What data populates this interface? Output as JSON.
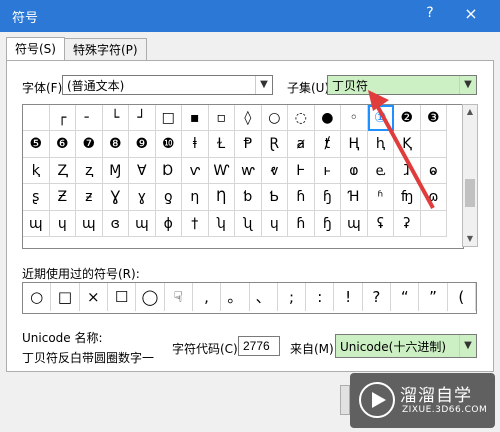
{
  "window": {
    "title": "符号",
    "help": "?",
    "close": "×"
  },
  "tabs": [
    {
      "label": "符号(S)"
    },
    {
      "label": "特殊字符(P)"
    }
  ],
  "font": {
    "label": "字体(F):",
    "value": "(普通文本)"
  },
  "subset": {
    "label": "子集(U):",
    "value": "丁贝符"
  },
  "symbols": [
    [
      "",
      "┌",
      "╴",
      "└",
      "┘",
      "□",
      "▪",
      "▫",
      "◊",
      "○",
      "◌",
      "●",
      "◦",
      "①",
      "❷",
      "❸",
      "❹"
    ],
    [
      "❺",
      "❻",
      "❼",
      "❽",
      "❾",
      "❿",
      "ⱡ",
      "Ɫ",
      "Ᵽ",
      "Ɽ",
      "ⱥ",
      "ⱦ",
      "Ⱨ",
      "ⱨ",
      "Ⱪ",
      "",
      ""
    ],
    [
      "ⱪ",
      "Ⱬ",
      "ⱬ",
      "Ɱ",
      "Ɐ",
      "Ɒ",
      "ⱱ",
      "Ⱳ",
      "ⱳ",
      "ⱴ",
      "Ⱶ",
      "ⱶ",
      "ⱷ",
      "ⱸ",
      "ⱹ",
      "ⱺ",
      ""
    ],
    [
      "ʂ",
      "Ƶ",
      "ƶ",
      "Ɣ",
      "ɣ",
      "ƍ",
      "ƞ",
      "Ƞ",
      "ƅ",
      "Ƅ",
      "ɦ",
      "ɧ",
      "Ɦ",
      "ʱ",
      "ʩ",
      "ɷ",
      ""
    ],
    [
      "ɰ",
      "ɥ",
      "ɰ",
      "ɞ",
      "ɰ",
      "ɸ",
      "†",
      "ʮ",
      "ʯ",
      "ɥ",
      "ɦ",
      "ɧ",
      "ɰ",
      "ʢ",
      "ʡ",
      "",
      ""
    ]
  ],
  "recent": {
    "label": "近期使用过的符号(R):",
    "items": [
      "○",
      "□",
      "×",
      "☐",
      "◯",
      "☟",
      ",",
      "。",
      "、",
      ";",
      ":",
      "!",
      "?",
      "“",
      "”",
      "("
    ]
  },
  "unicode": {
    "name_label": "Unicode 名称:",
    "name_value": "丁贝符反白带圆圈数字一"
  },
  "charcode": {
    "label": "字符代码(C):",
    "value": "2776"
  },
  "from": {
    "label": "来自(M):",
    "value": "Unicode(十六进制)"
  },
  "watermark": {
    "main": "溜溜自学",
    "sub": "ZIXUE.3D66.COM"
  },
  "colors": {
    "titlebar": "#2b78d6",
    "highlight": "#ccefc4",
    "annotation": "#e03c3c",
    "selection": "#1e90ff"
  }
}
